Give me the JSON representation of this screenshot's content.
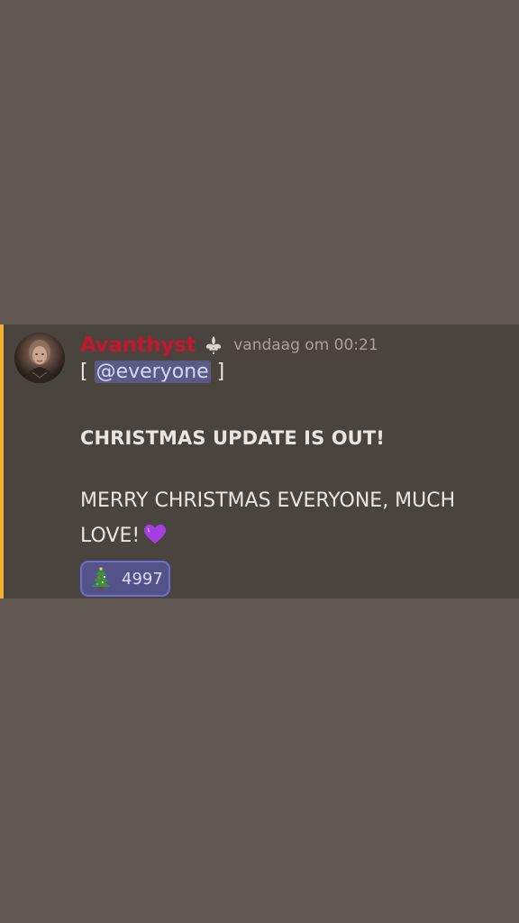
{
  "message": {
    "author": "Avanthyst",
    "role_icon": "fleur-de-lis-icon",
    "timestamp": "vandaag om 00:21",
    "mention_open": "[ ",
    "mention": "@everyone",
    "mention_close": " ]",
    "headline": "CHRISTMAS UPDATE IS OUT!",
    "body": "MERRY CHRISTMAS EVERYONE, MUCH LOVE!",
    "body_emoji": "purple-heart-icon",
    "reaction": {
      "emoji": "christmas-tree-icon",
      "count": "4997"
    }
  },
  "colors": {
    "background": "#615853",
    "message_highlight": "#49443d",
    "mention_accent": "#f0b132",
    "username": "#c4172b",
    "mention_pill": "#5a5b82",
    "reaction_border": "#6c6ec9"
  }
}
